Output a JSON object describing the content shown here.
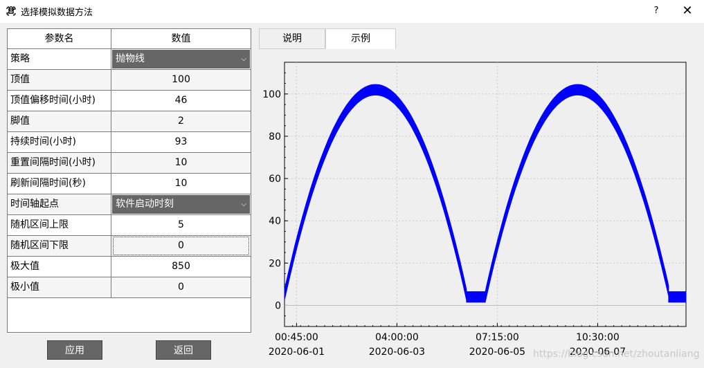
{
  "window": {
    "title": "选择模拟数据方法",
    "help_label": "?",
    "close_label": "✕",
    "icon": "command-icon"
  },
  "table": {
    "headers": [
      "参数名",
      "数值"
    ],
    "rows": [
      {
        "name": "策略",
        "value": "抛物线",
        "type": "combo"
      },
      {
        "name": "顶值",
        "value": "100"
      },
      {
        "name": "顶值偏移时间(小时)",
        "value": "46"
      },
      {
        "name": "脚值",
        "value": "2"
      },
      {
        "name": "持续时间(小时)",
        "value": "93"
      },
      {
        "name": "重置间隔时间(小时)",
        "value": "10"
      },
      {
        "name": "刷新间隔时间(秒)",
        "value": "10"
      },
      {
        "name": "时间轴起点",
        "value": "软件启动时刻",
        "type": "combo"
      },
      {
        "name": "随机区间上限",
        "value": "5"
      },
      {
        "name": "随机区间下限",
        "value": "0",
        "focused": true
      },
      {
        "name": "极大值",
        "value": "850"
      },
      {
        "name": "极小值",
        "value": "0"
      }
    ]
  },
  "buttons": {
    "apply": "应用",
    "back": "返回"
  },
  "tabs": [
    {
      "label": "说明",
      "active": false
    },
    {
      "label": "示例",
      "active": true
    }
  ],
  "watermark": "https://blog.csdn.net/zhoutanliang",
  "chart_data": {
    "type": "line",
    "series_color": "#0000ff",
    "grid": true,
    "ylim": [
      -10,
      115
    ],
    "yticks": [
      0,
      20,
      40,
      60,
      80,
      100
    ],
    "xlim_hours": [
      0,
      150
    ],
    "xticks": [
      {
        "hours": 4.5,
        "time": "00:45:00",
        "date": "2020-06-01"
      },
      {
        "hours": 42,
        "time": "04:00:00",
        "date": "2020-06-03"
      },
      {
        "hours": 79.5,
        "time": "07:15:00",
        "date": "2020-06-05"
      },
      {
        "hours": 117,
        "time": "10:30:00",
        "date": "2020-06-07"
      }
    ],
    "series": [
      {
        "segment": "parabola",
        "start_hours": 0,
        "peak_hours": 34,
        "end_hours": 68,
        "base": 5,
        "peak": 102
      },
      {
        "segment": "flat",
        "start_hours": 68,
        "end_hours": 75,
        "value": 4
      },
      {
        "segment": "parabola",
        "start_hours": 75,
        "peak_hours": 109.5,
        "end_hours": 143.5,
        "base": 4,
        "peak": 102
      },
      {
        "segment": "flat",
        "start_hours": 143.5,
        "end_hours": 150,
        "value": 4
      }
    ],
    "band_width": 5
  }
}
